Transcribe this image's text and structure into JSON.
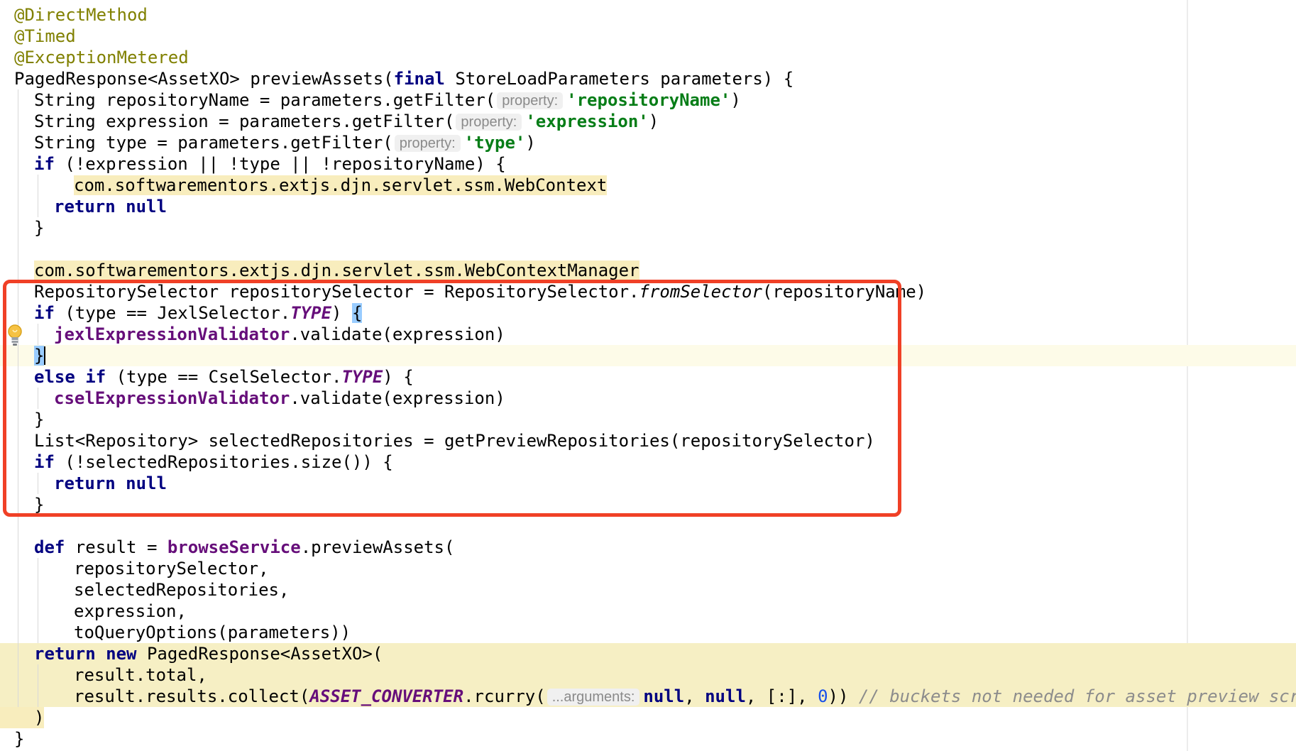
{
  "editor": {
    "language": "groovy",
    "highlight_color": "#f04026",
    "intention_icon": "lightbulb-icon",
    "lines": {
      "l1": {
        "ann": "@DirectMethod"
      },
      "l2": {
        "ann": "@Timed"
      },
      "l3": {
        "ann": "@ExceptionMetered"
      },
      "l4": {
        "t1": "PagedResponse<AssetXO> previewAssets(",
        "kw1": "final",
        "t2": " StoreLoadParameters parameters) {"
      },
      "l5": {
        "t1": "String repositoryName = parameters.getFilter(",
        "hint": "property:",
        "str": "'repositoryName'",
        "t2": ")"
      },
      "l6": {
        "t1": "String expression = parameters.getFilter(",
        "hint": "property:",
        "str": "'expression'",
        "t2": ")"
      },
      "l7": {
        "t1": "String type = parameters.getFilter(",
        "hint": "property:",
        "str": "'type'",
        "t2": ")"
      },
      "l8": {
        "kw1": "if",
        "t1": " (!expression || !type || !repositoryName) {"
      },
      "l9": {
        "t1": "com.softwarementors.extjs.djn.servlet.ssm.WebContext"
      },
      "l10": {
        "kw1": "return",
        "t1": " ",
        "kw2": "null"
      },
      "l11": {
        "t1": "}"
      },
      "l13": {
        "t1": "com.softwarementors.extjs.djn.servlet.ssm.WebContextManager"
      },
      "l14": {
        "t1": "RepositorySelector repositorySelector = RepositorySelector.",
        "it": "fromSelector",
        "t2": "(repositoryName)"
      },
      "l15": {
        "kw1": "if",
        "t1": " (type == JexlSelector.",
        "cst": "TYPE",
        "t2": ") ",
        "brace": "{"
      },
      "l16": {
        "fld": "jexlExpressionValidator",
        "t1": ".validate(expression)"
      },
      "l17": {
        "brace": "}"
      },
      "l18": {
        "kw1": "else",
        "t1": " ",
        "kw2": "if",
        "t2": " (type == CselSelector.",
        "cst": "TYPE",
        "t3": ") {"
      },
      "l19": {
        "fld": "cselExpressionValidator",
        "t1": ".validate(expression)"
      },
      "l20": {
        "t1": "}"
      },
      "l21": {
        "t1": "List<Repository> selectedRepositories = getPreviewRepositories(repositorySelector)"
      },
      "l22": {
        "kw1": "if",
        "t1": " (!selectedRepositories.size()) {"
      },
      "l23": {
        "kw1": "return",
        "t1": " ",
        "kw2": "null"
      },
      "l24": {
        "t1": "}"
      },
      "l26": {
        "kw1": "def",
        "t1": " result = ",
        "fld": "browseService",
        "t2": ".previewAssets("
      },
      "l27": {
        "t1": "repositorySelector,"
      },
      "l28": {
        "t1": "selectedRepositories,"
      },
      "l29": {
        "t1": "expression,"
      },
      "l30": {
        "t1": "toQueryOptions(parameters))"
      },
      "l31": {
        "kw1": "return",
        "t1": " ",
        "kw2": "new",
        "t2": " PagedResponse<AssetXO>("
      },
      "l32": {
        "t1": "result.total,"
      },
      "l33": {
        "t1": "result.results.collect(",
        "cst": "ASSET_CONVERTER",
        "t2": ".rcurry(",
        "hint": "...arguments:",
        "kw1": "null",
        "t3": ", ",
        "kw2": "null",
        "t4": ", [:], ",
        "num": "0",
        "t5": ")) ",
        "cmt": "// buckets not needed for asset preview scree"
      },
      "l34": {
        "t1": ")"
      },
      "l35": {
        "t1": "}"
      }
    }
  }
}
